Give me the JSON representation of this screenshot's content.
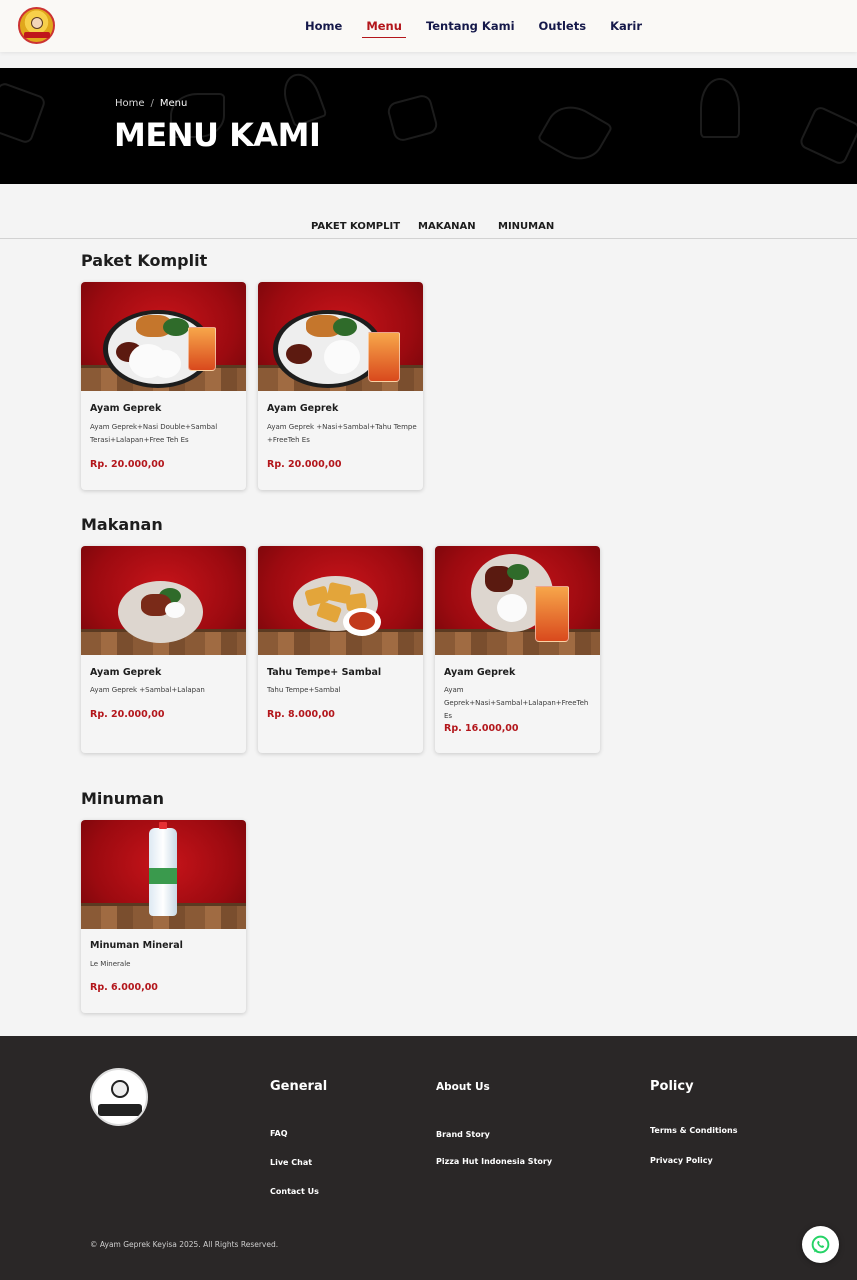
{
  "nav": {
    "items": [
      {
        "label": "Home",
        "active": false
      },
      {
        "label": "Menu",
        "active": true
      },
      {
        "label": "Tentang Kami",
        "active": false
      },
      {
        "label": "Outlets",
        "active": false
      },
      {
        "label": "Karir",
        "active": false
      }
    ]
  },
  "hero": {
    "breadcrumb": {
      "home": "Home",
      "separator": "/",
      "current": "Menu"
    },
    "title": "MENU KAMI"
  },
  "tabs": [
    "PAKET KOMPLIT",
    "MAKANAN",
    "MINUMAN"
  ],
  "sections": [
    {
      "title": "Paket Komplit",
      "items": [
        {
          "name": "Ayam Geprek",
          "desc": "Ayam Geprek+Nasi Double+Sambal Terasi+Lalapan+Free Teh Es",
          "price": "Rp. 20.000,00",
          "image_icon": "ayam-geprek-combo-image"
        },
        {
          "name": "Ayam Geprek",
          "desc": "Ayam Geprek +Nasi+Sambal+Tahu Tempe +FreeTeh Es",
          "price": "Rp. 20.000,00",
          "image_icon": "ayam-geprek-combo-image"
        }
      ]
    },
    {
      "title": "Makanan",
      "items": [
        {
          "name": "Ayam Geprek",
          "desc": "Ayam Geprek +Sambal+Lalapan",
          "price": "Rp. 20.000,00",
          "image_icon": "ayam-geprek-plate-image"
        },
        {
          "name": "Tahu Tempe+ Sambal",
          "desc": "Tahu Tempe+Sambal",
          "price": "Rp. 8.000,00",
          "image_icon": "tahu-tempe-image"
        },
        {
          "name": "Ayam Geprek",
          "desc": "Ayam Geprek+Nasi+Sambal+Lalapan+FreeTeh Es",
          "price": "Rp. 16.000,00",
          "image_icon": "ayam-geprek-combo-image"
        }
      ]
    },
    {
      "title": "Minuman",
      "items": [
        {
          "name": "Minuman Mineral",
          "desc": "Le Minerale",
          "price": "Rp. 6.000,00",
          "image_icon": "water-bottle-image"
        }
      ]
    }
  ],
  "footer": {
    "general": {
      "heading": "General",
      "links": [
        "FAQ",
        "Live Chat",
        "Contact Us"
      ]
    },
    "about": {
      "heading": "About Us",
      "links": [
        "Brand Story",
        "Pizza Hut Indonesia Story"
      ]
    },
    "policy": {
      "heading": "Policy",
      "links": [
        "Terms & Conditions",
        "Privacy Policy"
      ]
    },
    "copyright": "© Ayam Geprek Keyisa 2025. All Rights Reserved."
  },
  "colors": {
    "accent": "#b3161b",
    "nav_text": "#15194a",
    "hero_bg": "#000000",
    "footer_bg": "#2a2727",
    "page_bg": "#f4f4f4"
  },
  "icons": {
    "logo": "brand-logo-icon",
    "whatsapp": "whatsapp-icon"
  }
}
